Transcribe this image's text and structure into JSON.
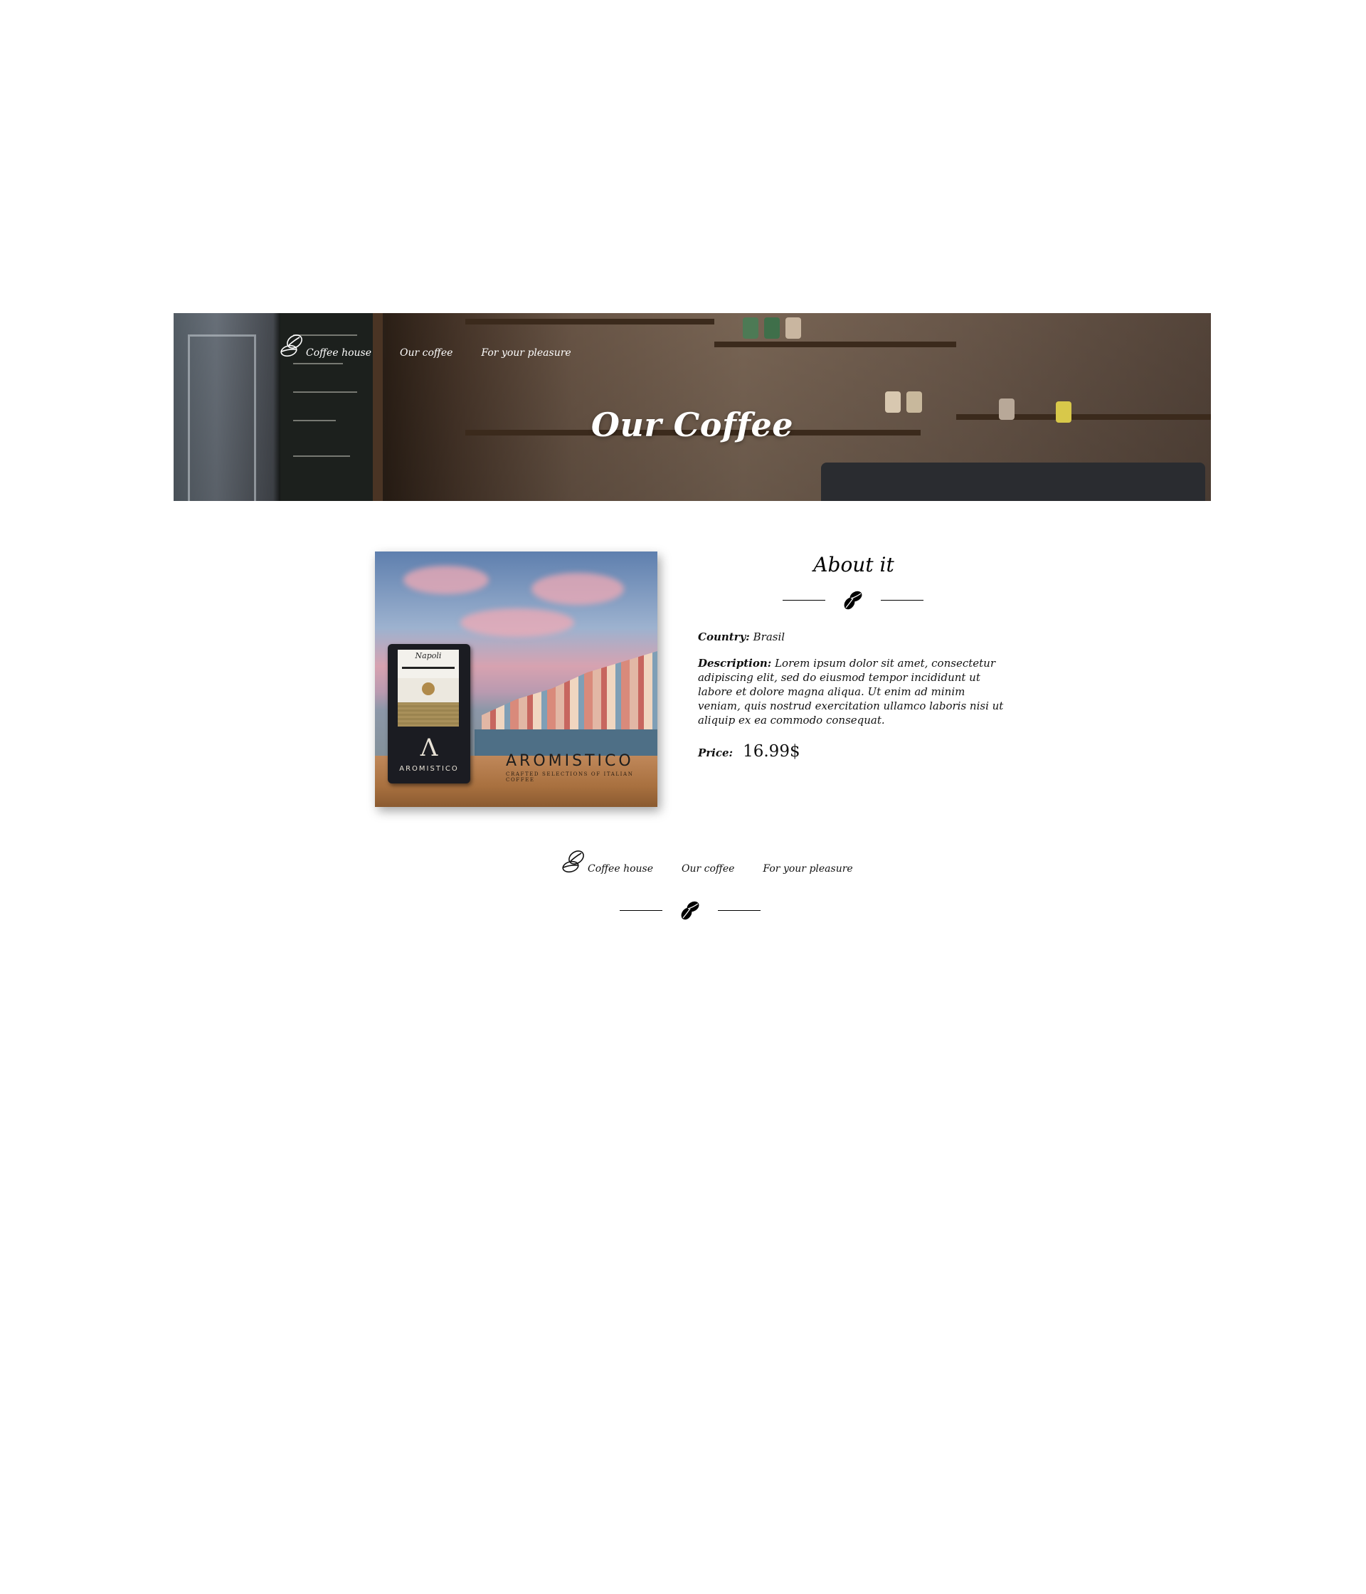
{
  "header": {
    "nav": {
      "home_label": "Coffee house",
      "our_coffee_label": "Our coffee",
      "pleasure_label": "For your pleasure"
    },
    "title": "Our Coffee",
    "logo_icon": "coffee-beans-outline-icon"
  },
  "product": {
    "image": {
      "bag_name": "Napoli",
      "bag_brand": "AROMISTICO",
      "brand_text": "AROMISTICO",
      "brand_subtext": "CRAFTED SELECTIONS OF ITALIAN COFFEE"
    },
    "about": {
      "title": "About it",
      "divider_icon": "coffee-beans-icon"
    },
    "country": {
      "label": "Country:",
      "value": "Brasil"
    },
    "description": {
      "label": "Description:",
      "value": "Lorem ipsum dolor sit amet, consectetur adipiscing elit, sed do eiusmod tempor incididunt ut labore et dolore magna aliqua. Ut enim ad minim veniam, quis nostrud exercitation ullamco laboris nisi ut aliquip ex ea commodo consequat."
    },
    "price": {
      "label": "Price:",
      "value": "16.99$"
    }
  },
  "footer": {
    "nav": {
      "home_label": "Coffee house",
      "our_coffee_label": "Our coffee",
      "pleasure_label": "For your pleasure"
    },
    "divider_icon": "coffee-beans-icon"
  },
  "colors": {
    "text": "#000000",
    "hero_text": "#ffffff",
    "background": "#ffffff"
  }
}
